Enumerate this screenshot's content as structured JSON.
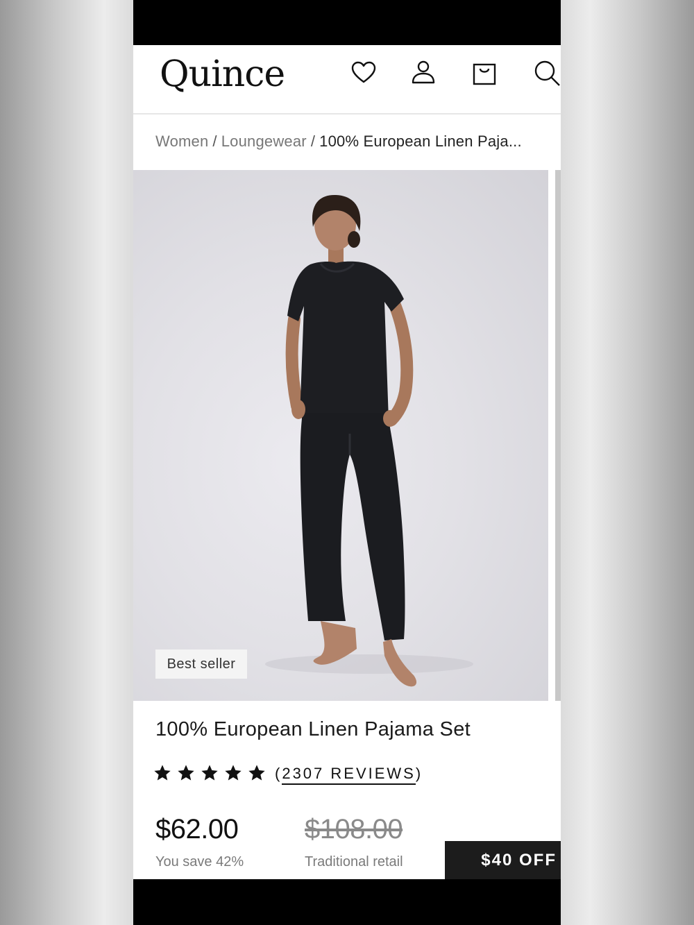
{
  "header": {
    "logo": "Quince",
    "icons": [
      "heart-icon",
      "account-icon",
      "shopping-bag-icon",
      "search-icon"
    ]
  },
  "breadcrumb": {
    "items": [
      "Women",
      "Loungewear",
      "100% European Linen Paja..."
    ],
    "separator": "/"
  },
  "product": {
    "badge": "Best seller",
    "title": "100% European Linen Pajama Set",
    "rating": 5,
    "reviews_count": "2307",
    "reviews_label": "2307 REVIEWS",
    "price": "$62.00",
    "savings": "You save 42%",
    "retail_price": "$108.00",
    "retail_label": "Traditional retail",
    "discount_tag": "$40 OFF"
  },
  "colors": {
    "text": "#111111",
    "muted": "#7a7a7a",
    "tag_bg": "#1c1c1c"
  }
}
